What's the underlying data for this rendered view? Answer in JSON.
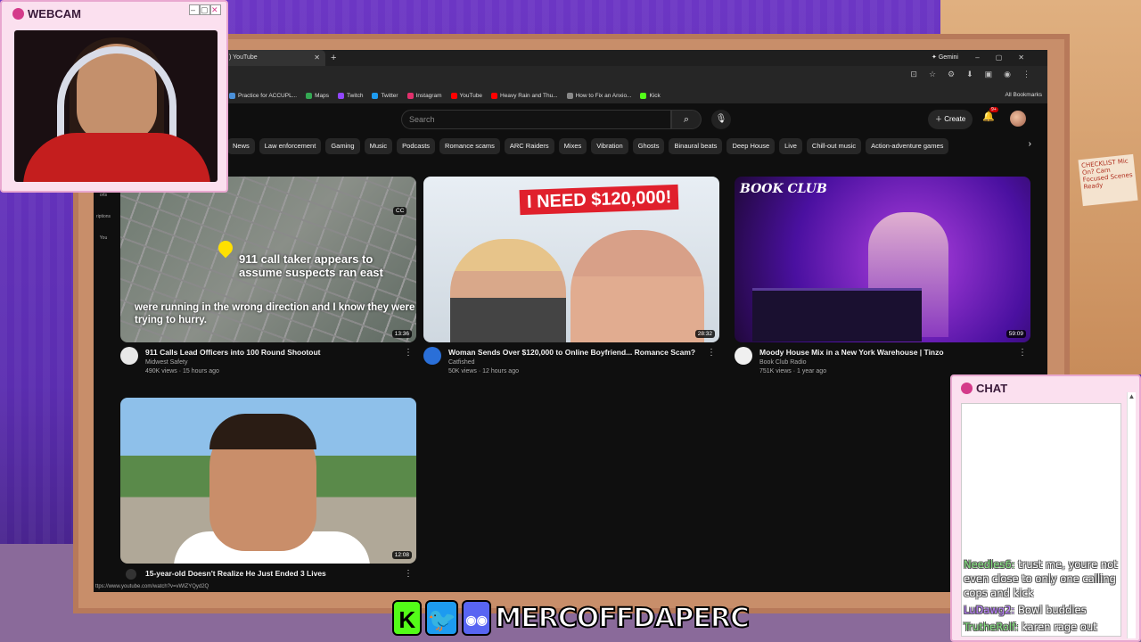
{
  "browser": {
    "tab_title": ") YouTube",
    "gemini_label": "Gemini",
    "bookmarks": [
      {
        "label": "Practice for ACCUPL...",
        "color": "#4a90d9"
      },
      {
        "label": "Maps",
        "color": "#34a853"
      },
      {
        "label": "Twitch",
        "color": "#9146ff"
      },
      {
        "label": "Twitter",
        "color": "#1d9bf0"
      },
      {
        "label": "Instagram",
        "color": "#e1306c"
      },
      {
        "label": "YouTube",
        "color": "#ff0000"
      },
      {
        "label": "Heavy Rain and Thu...",
        "color": "#ff0000"
      },
      {
        "label": "How to Fix an Anxio...",
        "color": "#888888"
      },
      {
        "label": "Kick",
        "color": "#53fc18"
      }
    ],
    "all_bookmarks": "All Bookmarks",
    "status_url": "ttps://www.youtube.com/watch?v=vWlZYQyd2Q"
  },
  "youtube": {
    "search_placeholder": "Search",
    "create_label": "Create",
    "notification_badge": "9+",
    "chips": [
      "News",
      "Law enforcement",
      "Gaming",
      "Music",
      "Podcasts",
      "Romance scams",
      "ARC Raiders",
      "Mixes",
      "Vibration",
      "Ghosts",
      "Binaural beats",
      "Deep House",
      "Live",
      "Chill-out music",
      "Action-adventure games"
    ],
    "sidebar": [
      "orts",
      "riptions",
      "You"
    ],
    "videos": [
      {
        "title": "911 Calls Lead Officers into 100 Round Shootout",
        "channel": "Midwest Safety",
        "stats": "490K views · 15 hours ago",
        "duration": "13:36",
        "thumb_caption": "911 call taker appears to assume suspects ran east",
        "thumb_sub": "were running in the wrong direction and I know they were trying to hurry.",
        "thumb_badge": "CC"
      },
      {
        "title": "Woman Sends Over $120,000 to Online Boyfriend... Romance Scam?",
        "channel": "Catfished",
        "stats": "50K views · 12 hours ago",
        "duration": "28:32",
        "thumb_text": "I NEED $120,000!"
      },
      {
        "title": "Moody House Mix in a New York Warehouse | Tinzo",
        "channel": "Book Club Radio",
        "stats": "751K views · 1 year ago",
        "duration": "59:09",
        "thumb_text": "BOOK CLUB"
      },
      {
        "title": "15-year-old Doesn't Realize He Just Ended 3 Lives",
        "channel": "",
        "stats": "",
        "duration": "12:08"
      }
    ]
  },
  "overlay": {
    "webcam_title": "WEBCAM",
    "chat_title": "CHAT",
    "sticky_note": "CHECKLIST Mic On? Cam Focused Scenes Ready",
    "chat_messages": [
      {
        "user": "Needles6:",
        "text": " trust me, youre not even close to only one calling cops and kick"
      },
      {
        "user": "LuDawg2:",
        "text": " Bowl buddies"
      },
      {
        "user": "TrutheRolf:",
        "text": " karen rage out"
      }
    ],
    "handle": "MERCOFFDAPERC"
  }
}
